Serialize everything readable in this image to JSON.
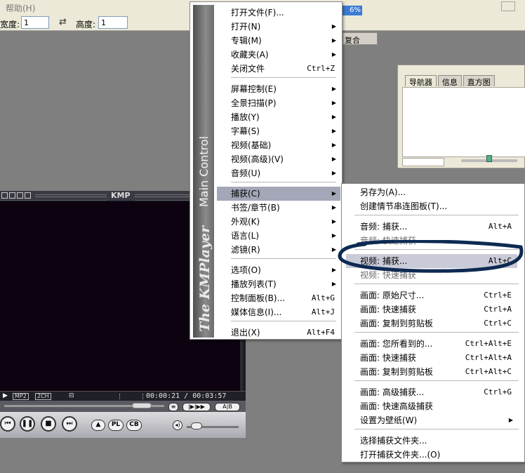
{
  "background_app": {
    "menu_help": "帮助(H)",
    "width_label": "宽度:",
    "width_value": "1",
    "height_label": "高度:",
    "height_value": "1",
    "progress_text": "6%",
    "tab_right_label": "复合",
    "navigator_tabs": [
      "导航器",
      "信息",
      "直方图"
    ]
  },
  "kmp": {
    "logo": "KMP",
    "status_badges": [
      "MP2",
      "2CH"
    ],
    "time": "00:00:21 / 00:03:57",
    "buttons": {
      "eject": "▲",
      "playlist": "PL",
      "control_box": "CB"
    },
    "repeat": "A|B"
  },
  "main_menu": {
    "sidebar_title": "The KMPlayer",
    "sidebar_subtitle": "Main Control",
    "items": [
      {
        "label": "打开文件(F)...",
        "shortcut": "",
        "arrow": false
      },
      {
        "label": "打开(N)",
        "shortcut": "",
        "arrow": true
      },
      {
        "label": "专辑(M)",
        "shortcut": "",
        "arrow": true
      },
      {
        "label": "收藏夹(A)",
        "shortcut": "",
        "arrow": true
      },
      {
        "label": "关闭文件",
        "shortcut": "Ctrl+Z",
        "arrow": false
      },
      {
        "label": "屏幕控制(E)",
        "shortcut": "",
        "arrow": true
      },
      {
        "label": "全景扫描(P)",
        "shortcut": "",
        "arrow": true
      },
      {
        "label": "播放(Y)",
        "shortcut": "",
        "arrow": true
      },
      {
        "label": "字幕(S)",
        "shortcut": "",
        "arrow": true
      },
      {
        "label": "视频(基础)",
        "shortcut": "",
        "arrow": true
      },
      {
        "label": "视频(高级)(V)",
        "shortcut": "",
        "arrow": true
      },
      {
        "label": "音频(U)",
        "shortcut": "",
        "arrow": true
      },
      {
        "label": "捕获(C)",
        "shortcut": "",
        "arrow": true
      },
      {
        "label": "书签/章节(B)",
        "shortcut": "",
        "arrow": true
      },
      {
        "label": "外观(K)",
        "shortcut": "",
        "arrow": true
      },
      {
        "label": "语言(L)",
        "shortcut": "",
        "arrow": true
      },
      {
        "label": "滤镜(R)",
        "shortcut": "",
        "arrow": true
      },
      {
        "label": "选项(O)",
        "shortcut": "",
        "arrow": true
      },
      {
        "label": "播放列表(T)",
        "shortcut": "",
        "arrow": true
      },
      {
        "label": "控制面板(B)...",
        "shortcut": "Alt+G",
        "arrow": false
      },
      {
        "label": "媒体信息(I)...",
        "shortcut": "Alt+J",
        "arrow": false
      },
      {
        "label": "退出(X)",
        "shortcut": "Alt+F4",
        "arrow": false
      }
    ]
  },
  "capture_menu": {
    "items": [
      {
        "label": "另存为(A)...",
        "shortcut": ""
      },
      {
        "label": "创建情节串连图板(T)...",
        "shortcut": ""
      },
      {
        "label": "音频: 捕获...",
        "shortcut": "Alt+A"
      },
      {
        "label": "音频: 快速捕获",
        "shortcut": ""
      },
      {
        "label": "视频: 捕获...",
        "shortcut": "Alt+C"
      },
      {
        "label": "视频: 快速捕获",
        "shortcut": ""
      },
      {
        "label": "画面: 原始尺寸...",
        "shortcut": "Ctrl+E"
      },
      {
        "label": "画面: 快速捕获",
        "shortcut": "Ctrl+A"
      },
      {
        "label": "画面: 复制到剪贴板",
        "shortcut": "Ctrl+C"
      },
      {
        "label": "画面: 您所看到的...",
        "shortcut": "Ctrl+Alt+E"
      },
      {
        "label": "画面: 快速捕获",
        "shortcut": "Ctrl+Alt+A"
      },
      {
        "label": "画面: 复制到剪贴板",
        "shortcut": "Ctrl+Alt+C"
      },
      {
        "label": "画面: 高级捕获...",
        "shortcut": "Ctrl+G"
      },
      {
        "label": "画面: 快速高级捕获",
        "shortcut": ""
      },
      {
        "label": "设置为壁纸(W)",
        "shortcut": ""
      },
      {
        "label": "选择捕获文件夹...",
        "shortcut": ""
      },
      {
        "label": "打开捕获文件夹...(O)",
        "shortcut": ""
      }
    ]
  },
  "colors": {
    "highlight": "#a3a7b8",
    "annotation_loop": "#0d2a52"
  }
}
